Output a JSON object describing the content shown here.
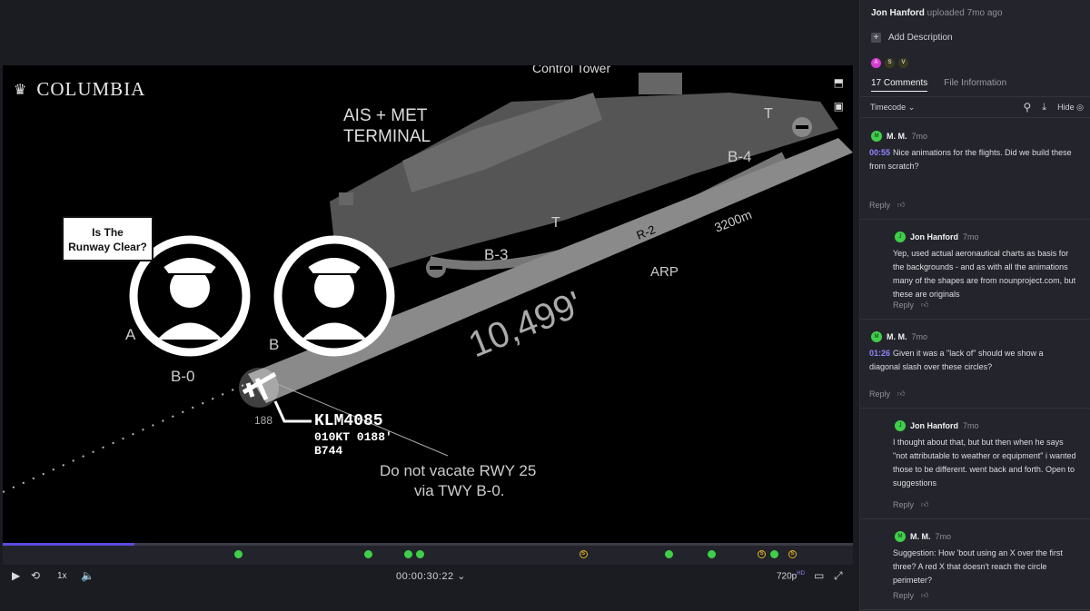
{
  "video": {
    "brand": "COLUMBIA",
    "bubble_line1": "Is The",
    "bubble_line2": "Runway Clear?",
    "labels": {
      "control_tower": "Control Tower",
      "ais_met_1": "AIS + MET",
      "ais_met_2": "TERMINAL",
      "b4": "B-4",
      "b3": "B-3",
      "b0": "B-0",
      "t1": "T",
      "t2": "T",
      "r2": "R-2",
      "arp": "ARP",
      "dist": "3200m",
      "runway_length": "10,499'",
      "callsign": "KLM4085",
      "flight_line2": "010KT 0188'",
      "flight_line3": "B744",
      "heading": "188",
      "a_label": "A",
      "b_label": "B",
      "instruction1": "Do not vacate RWY 25",
      "instruction2": "via TWY B-0."
    }
  },
  "timeline": {
    "progress_percent": 15.5,
    "markers": [
      {
        "type": "green",
        "pos": 27.2
      },
      {
        "type": "green",
        "pos": 42.5
      },
      {
        "type": "green",
        "pos": 47.2
      },
      {
        "type": "green",
        "pos": 48.6
      },
      {
        "type": "amber",
        "pos": 67.8
      },
      {
        "type": "green",
        "pos": 77.9
      },
      {
        "type": "green",
        "pos": 82.9
      },
      {
        "type": "amber",
        "pos": 88.8
      },
      {
        "type": "green",
        "pos": 90.3
      },
      {
        "type": "amber",
        "pos": 92.4
      }
    ]
  },
  "controls": {
    "speed": "1x",
    "timecode": "00:00:30:22",
    "quality": "720p",
    "quality_badge": "HD"
  },
  "panel": {
    "uploader_name": "Jon Hanford",
    "uploader_meta": "uploaded 7mo ago",
    "add_description": "Add Description",
    "avatars": [
      {
        "letter": "A",
        "color": "#d63ad1"
      },
      {
        "letter": "S",
        "color": "#3a3a20"
      },
      {
        "letter": "V",
        "color": "#3a3a20"
      }
    ],
    "tabs": [
      "17 Comments",
      "File Information"
    ],
    "sort_label": "Timecode",
    "hide_label": "Hide",
    "comments": [
      {
        "initial": "M",
        "name": "M. M.",
        "time": "7mo",
        "timestamp": "00:55",
        "text": "Nice animations for the flights. Did we build these from scratch?",
        "reply": "Reply",
        "indent": false
      },
      {
        "initial": "J",
        "name": "Jon Hanford",
        "time": "7mo",
        "timestamp": "",
        "text": "Yep, used actual aeronautical charts as basis for the backgrounds - and as with all the animations many of the shapes are from nounproject.com, but these are originals",
        "reply": "Reply",
        "indent": true
      },
      {
        "initial": "M",
        "name": "M. M.",
        "time": "7mo",
        "timestamp": "01:26",
        "text": "Given it was a \"lack of\" should we show a diagonal slash over these circles?",
        "reply": "Reply",
        "indent": false
      },
      {
        "initial": "J",
        "name": "Jon Hanford",
        "time": "7mo",
        "timestamp": "",
        "text": "I thought about that, but but then when he says \"not attributable to weather or equipment\" i wanted those to be different. went back and forth. Open to suggestions",
        "reply": "Reply",
        "indent": true
      },
      {
        "initial": "M",
        "name": "M. M.",
        "time": "7mo",
        "timestamp": "",
        "text": "Suggestion: How 'bout using an X over the first three? A red X that doesn't reach the circle perimeter?",
        "reply": "Reply",
        "indent": true
      }
    ]
  }
}
